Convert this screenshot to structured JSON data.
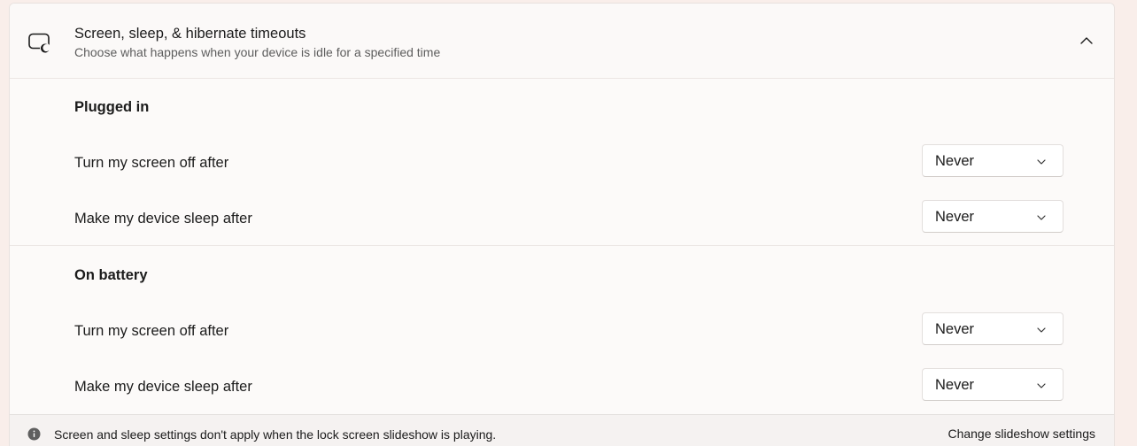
{
  "header": {
    "icon": "screen-sleep-icon",
    "title": "Screen, sleep, & hibernate timeouts",
    "subtitle": "Choose what happens when your device is idle for a specified time",
    "collapse_icon": "chevron-up-icon"
  },
  "plugged_in": {
    "title": "Plugged in",
    "screen_off": {
      "label": "Turn my screen off after",
      "value": "Never"
    },
    "sleep": {
      "label": "Make my device sleep after",
      "value": "Never"
    }
  },
  "on_battery": {
    "title": "On battery",
    "screen_off": {
      "label": "Turn my screen off after",
      "value": "Never"
    },
    "sleep": {
      "label": "Make my device sleep after",
      "value": "Never"
    }
  },
  "footer": {
    "icon": "info-icon",
    "text": "Screen and sleep settings don't apply when the lock screen slideshow is playing.",
    "link": "Change slideshow settings"
  },
  "colors": {
    "background": "#f9eeea",
    "card": "#fcfaf9",
    "text": "#1b1b1b",
    "secondary_text": "#5d5d5d"
  }
}
